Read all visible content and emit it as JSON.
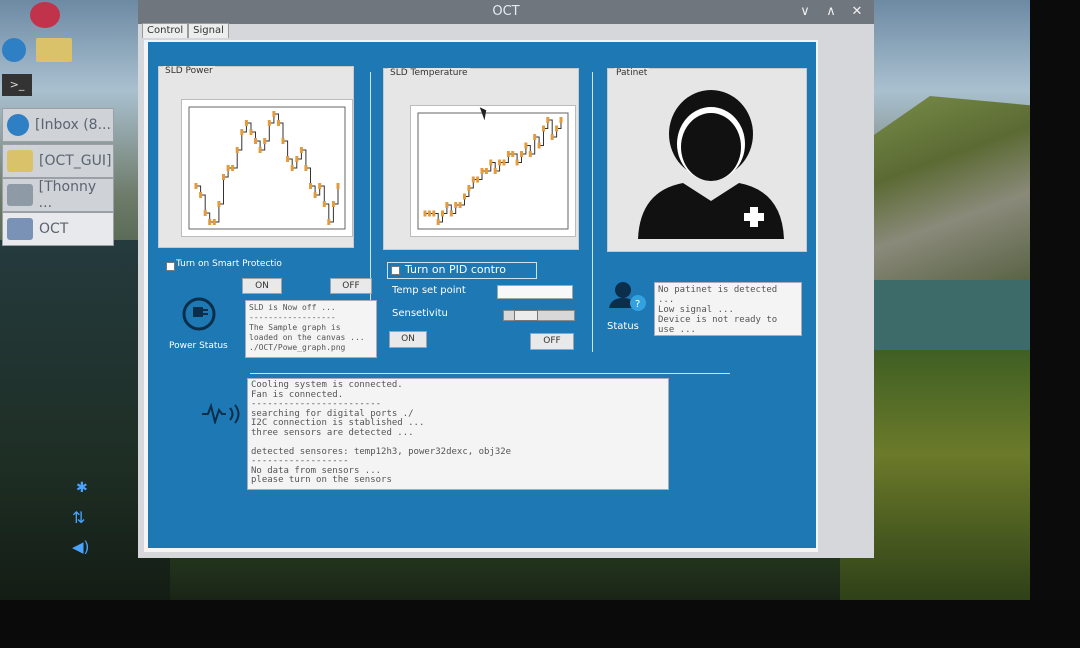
{
  "window": {
    "title": "OCT",
    "tabs": [
      "Control",
      "Signal"
    ],
    "controls": {
      "minimize": "∨",
      "maximize": "∧",
      "close": "✕"
    }
  },
  "taskbar": {
    "items": [
      {
        "label": "[Inbox (8...",
        "icon": "chromium-icon",
        "color": "#2e7fc4"
      },
      {
        "label": "[OCT_GUI]",
        "icon": "folder-icon",
        "color": "#d9c26a"
      },
      {
        "label": "[Thonny ...",
        "icon": "thonny-icon",
        "color": "#8e9aa6"
      },
      {
        "label": "OCT",
        "icon": "window-icon",
        "color": "#7a92b5"
      }
    ]
  },
  "power": {
    "group_label": "SLD Power",
    "smart_protection_label": "Turn on Smart Protectio",
    "on_label": "ON",
    "off_label": "OFF",
    "status_label": "Power Status",
    "log": [
      "SLD is Now off ...",
      "------------------",
      "The Sample graph is",
      "loaded on the canvas ...",
      "./OCT/Powe_graph.png"
    ]
  },
  "temperature": {
    "group_label": "SLD Temperature",
    "pid_label": "Turn on PID contro",
    "temp_set_point_label": "Temp set point",
    "temp_set_point_value": "",
    "sensitivity_label": "Sensetivitu",
    "sensitivity_level": 0.2,
    "on_label": "ON",
    "off_label": "OFF"
  },
  "patient": {
    "group_label": "Patinet",
    "status_label": "Status",
    "log": [
      "No patinet is detected ...",
      "Low signal ...",
      "Device is not ready to use ..."
    ]
  },
  "system_log": [
    "Cooling system is connected.",
    "Fan is connected.",
    "------------------------",
    "searching for digital ports ./",
    "I2C connection is stablished ...",
    "three sensors are detected ...",
    "",
    "detected sensores: temp12h3, power32dexc, obj32e",
    "------------------",
    "No data from sensors ...",
    "please turn on the sensors"
  ],
  "chart_data": [
    {
      "type": "line",
      "title": "SLD Power",
      "values": [
        5,
        4,
        2,
        1,
        1,
        3,
        6,
        7,
        7,
        9,
        11,
        12,
        11,
        10,
        9,
        10,
        12,
        13,
        12,
        10,
        8,
        7,
        8,
        9,
        7,
        5,
        4,
        5,
        3,
        1,
        3,
        5
      ]
    },
    {
      "type": "line",
      "title": "SLD Temperature",
      "values": [
        1,
        1,
        1,
        0,
        1,
        2,
        1,
        2,
        2,
        3,
        4,
        5,
        5,
        6,
        6,
        7,
        6,
        7,
        7,
        8,
        8,
        7,
        8,
        9,
        8,
        10,
        9,
        11,
        12,
        10,
        11,
        12
      ]
    }
  ]
}
